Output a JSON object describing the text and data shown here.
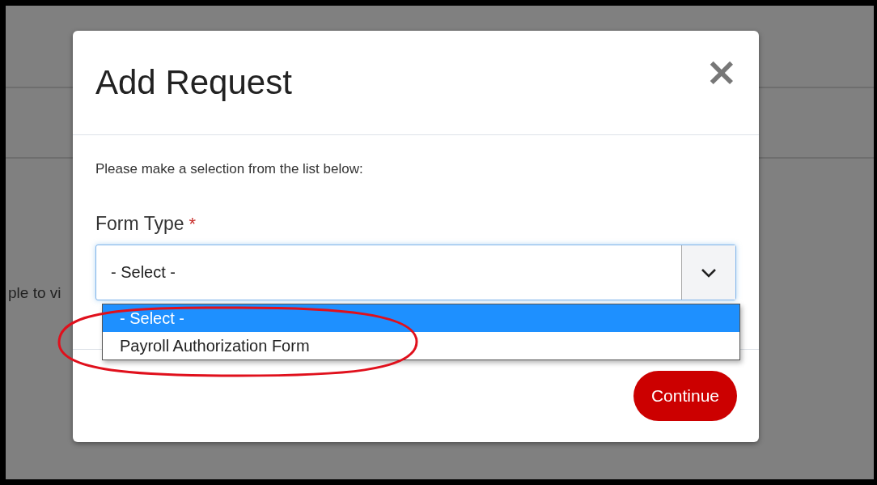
{
  "background_page": {
    "text": "ple to vi"
  },
  "dialog": {
    "title": "Add Request",
    "close": "×",
    "instruction": "Please make a selection from the list below:",
    "field": {
      "label": "Form Type",
      "required_mark": "*",
      "value": "- Select -",
      "options": [
        {
          "label": "- Select -",
          "selected": true
        },
        {
          "label": "Payroll Authorization Form",
          "selected": false
        }
      ]
    },
    "buttons": [
      "Continue"
    ]
  },
  "annotation": {
    "kind": "ellipse"
  }
}
